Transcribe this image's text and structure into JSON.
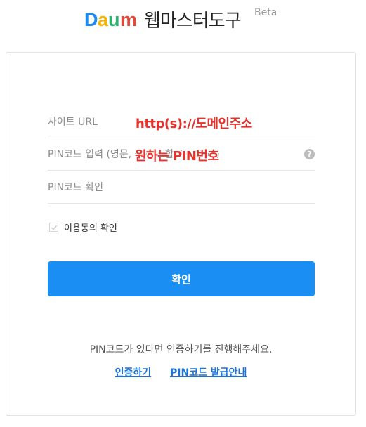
{
  "header": {
    "logo_text": "Daum",
    "title": "웹마스터도구",
    "beta": "Beta"
  },
  "form": {
    "site_url_placeholder": "사이트 URL",
    "pin_input_placeholder": "PIN코드 입력 (영문, 숫자 조합 4~8자리)",
    "pin_confirm_placeholder": "PIN코드 확인",
    "help_icon_label": "?",
    "agree_label": "이용동의 확인",
    "confirm_label": "확인"
  },
  "annotations": {
    "url_hint": "http(s)://도메인주소",
    "pin_hint": "원하는 PIN번호"
  },
  "footer": {
    "notice": "PIN코드가 있다면 인증하기를 진행해주세요.",
    "verify_link": "인증하기",
    "issue_link": "PIN코드 발급안내"
  },
  "colors": {
    "logo_d": "#1c8cf0",
    "logo_a": "#f4b400",
    "logo_u": "#29b36e",
    "logo_m": "#e4483a",
    "primary": "#1a8ef2",
    "hint": "#e5322d",
    "link": "#1a73d9"
  }
}
